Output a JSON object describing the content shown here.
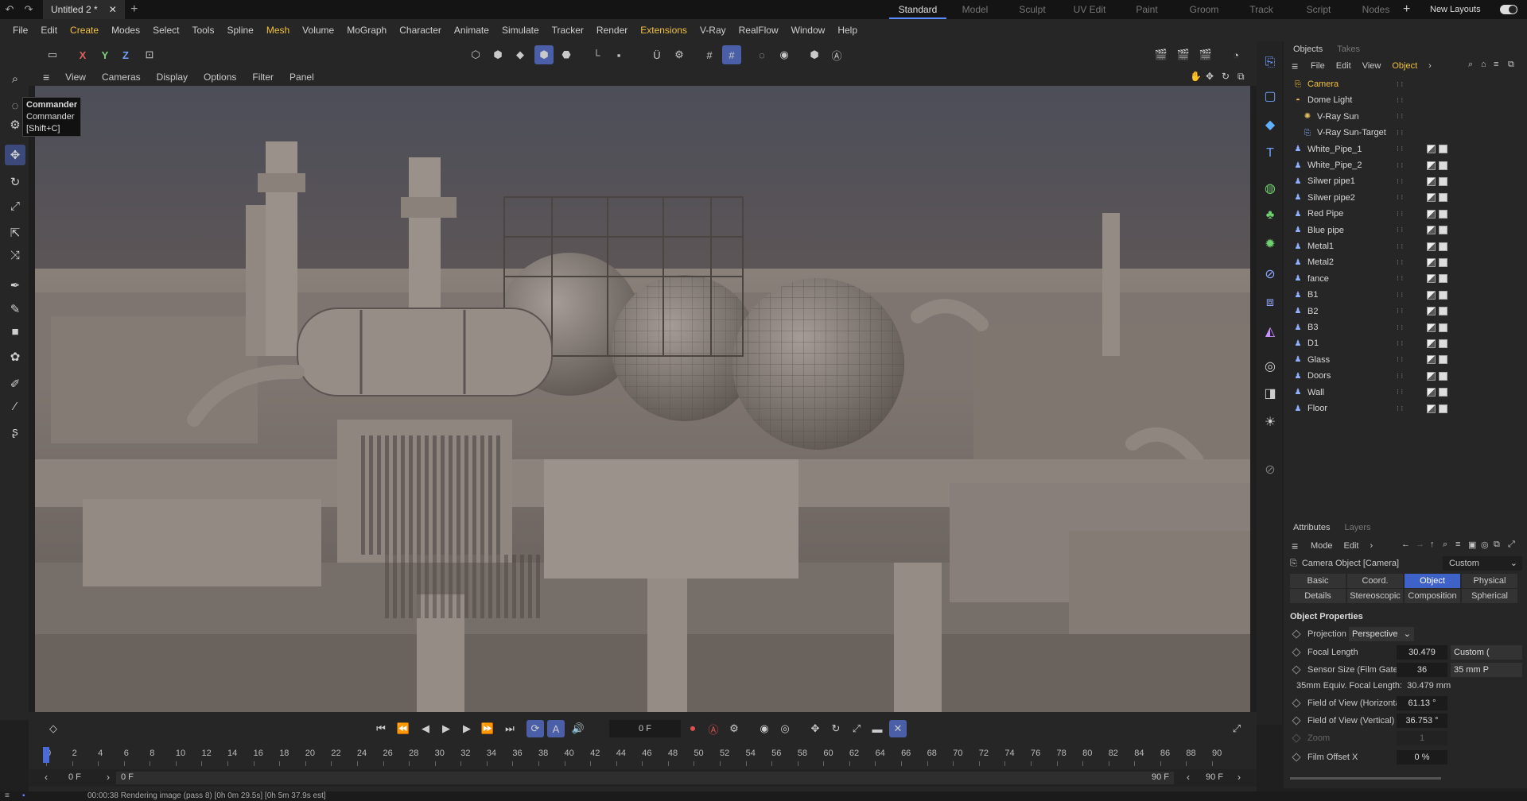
{
  "titlebar": {
    "doc_tab": "Untitled 2 *",
    "layouts": [
      "Standard",
      "Model",
      "Sculpt",
      "UV Edit",
      "Paint",
      "Groom",
      "Track",
      "Script",
      "Nodes"
    ],
    "active_layout": "Standard",
    "new_layouts": "New Layouts"
  },
  "menubar": [
    "File",
    "Edit",
    "Create",
    "Modes",
    "Select",
    "Tools",
    "Spline",
    "Mesh",
    "Volume",
    "MoGraph",
    "Character",
    "Animate",
    "Simulate",
    "Tracker",
    "Render",
    "Extensions",
    "V-Ray",
    "RealFlow",
    "Window",
    "Help"
  ],
  "toolbar": {
    "x": "X",
    "y": "Y",
    "z": "Z"
  },
  "viewport_menu": [
    "View",
    "Cameras",
    "Display",
    "Options",
    "Filter",
    "Panel"
  ],
  "tooltip": {
    "title": "Commander",
    "name": "Commander",
    "shortcut": "[Shift+C]"
  },
  "objects_panel": {
    "tabs": [
      "Objects",
      "Takes"
    ],
    "menu": [
      "File",
      "Edit",
      "View",
      "Object"
    ],
    "items": [
      {
        "name": "Camera",
        "type": "camera",
        "highlight": true
      },
      {
        "name": "Dome Light",
        "type": "light"
      },
      {
        "name": "V-Ray Sun",
        "type": "sun"
      },
      {
        "name": "V-Ray Sun-Target",
        "type": "target"
      },
      {
        "name": "White_Pipe_1",
        "type": "mesh"
      },
      {
        "name": "White_Pipe_2",
        "type": "mesh"
      },
      {
        "name": "Silwer pipe1",
        "type": "mesh"
      },
      {
        "name": "Silwer pipe2",
        "type": "mesh"
      },
      {
        "name": "Red Pipe",
        "type": "mesh"
      },
      {
        "name": "Blue pipe",
        "type": "mesh"
      },
      {
        "name": "Metal1",
        "type": "mesh"
      },
      {
        "name": "Metal2",
        "type": "mesh"
      },
      {
        "name": "fance",
        "type": "mesh"
      },
      {
        "name": "B1",
        "type": "mesh"
      },
      {
        "name": "B2",
        "type": "mesh"
      },
      {
        "name": "B3",
        "type": "mesh"
      },
      {
        "name": "D1",
        "type": "mesh"
      },
      {
        "name": "Glass",
        "type": "mesh"
      },
      {
        "name": "Doors",
        "type": "mesh"
      },
      {
        "name": "Wall",
        "type": "mesh"
      },
      {
        "name": "Floor",
        "type": "mesh"
      }
    ]
  },
  "attributes_panel": {
    "tabs": [
      "Attributes",
      "Layers"
    ],
    "menu": [
      "Mode",
      "Edit"
    ],
    "object_title": "Camera Object [Camera]",
    "preset": "Custom",
    "tab_row1": [
      "Basic",
      "Coord.",
      "Object",
      "Physical"
    ],
    "tab_row2": [
      "Details",
      "Stereoscopic",
      "Composition",
      "Spherical"
    ],
    "active_tab": "Object",
    "section": "Object Properties",
    "projection_label": "Projection",
    "projection_value": "Perspective",
    "focal_length_label": "Focal Length",
    "focal_length_value": "30.479",
    "focal_length_preset": "Custom (",
    "sensor_label": "Sensor Size (Film Gate)",
    "sensor_value": "36",
    "sensor_preset": "35 mm P",
    "equiv_label": "35mm Equiv. Focal Length:",
    "equiv_value": "30.479 mm",
    "fov_h_label": "Field of View (Horizontal)",
    "fov_h_value": "61.13 °",
    "fov_v_label": "Field of View (Vertical)",
    "fov_v_value": "36.753 °",
    "zoom_label": "Zoom",
    "zoom_value": "1",
    "film_offset_label": "Film Offset X",
    "film_offset_value": "0 %"
  },
  "timeline": {
    "current_frame": "0 F",
    "ruler": [
      "0",
      "2",
      "4",
      "6",
      "8",
      "10",
      "12",
      "14",
      "16",
      "18",
      "20",
      "22",
      "24",
      "26",
      "28",
      "30",
      "32",
      "34",
      "36",
      "38",
      "40",
      "42",
      "44",
      "46",
      "48",
      "50",
      "52",
      "54",
      "56",
      "58",
      "60",
      "62",
      "64",
      "66",
      "68",
      "70",
      "72",
      "74",
      "76",
      "78",
      "80",
      "82",
      "84",
      "86",
      "88",
      "90"
    ],
    "start_field": "0 F",
    "range_start": "0 F",
    "range_end": "90 F",
    "end_field": "90 F"
  },
  "status": "00:00:38 Rendering image (pass 8) [0h  0m 29.5s] [0h  5m 37.9s est]"
}
